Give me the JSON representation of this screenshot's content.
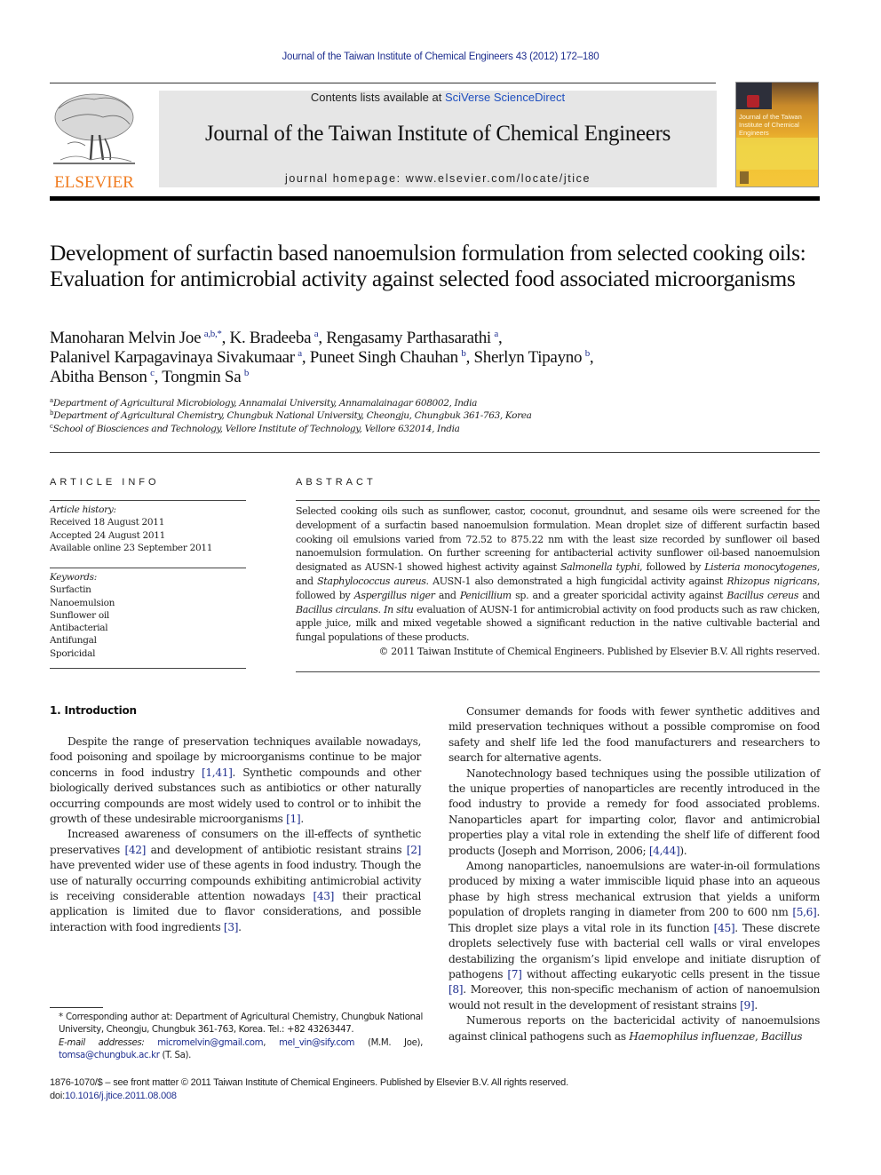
{
  "running_head": "Journal of the Taiwan Institute of Chemical Engineers 43 (2012) 172–180",
  "masthead": {
    "publisher_logo_text": "ELSEVIER",
    "contents_prefix": "Contents lists available at ",
    "contents_link": "SciVerse ScienceDirect",
    "journal_name": "Journal of the Taiwan Institute of Chemical Engineers",
    "homepage_label": "journal homepage: ",
    "homepage_url_text": "www.elsevier.com/locate/jtice",
    "cover_title": "Journal of the Taiwan Institute of Chemical Engineers",
    "colors": {
      "elsevier_orange": "#f07c20",
      "link_blue": "#1f2f8f",
      "banner_gray": "#e6e6e6"
    }
  },
  "article": {
    "title": "Development of surfactin based nanoemulsion formulation from selected cooking oils: Evaluation for antimicrobial activity against selected food associated microorganisms",
    "authors": [
      {
        "name": "Manoharan Melvin Joe",
        "sup": "a,b,*",
        "sep": ", "
      },
      {
        "name": "K. Bradeeba",
        "sup": "a",
        "sep": ", "
      },
      {
        "name": "Rengasamy Parthasarathi",
        "sup": "a",
        "sep": ","
      },
      {
        "name": "Palanivel Karpagavinaya Sivakumaar",
        "sup": "a",
        "sep": ", "
      },
      {
        "name": "Puneet Singh Chauhan",
        "sup": "b",
        "sep": ", "
      },
      {
        "name": "Sherlyn Tipayno",
        "sup": "b",
        "sep": ","
      },
      {
        "name": "Abitha Benson",
        "sup": "c",
        "sep": ", "
      },
      {
        "name": "Tongmin Sa",
        "sup": "b",
        "sep": ""
      }
    ],
    "affiliations": [
      {
        "key": "a",
        "text": "Department of Agricultural Microbiology, Annamalai University, Annamalainagar 608002, India"
      },
      {
        "key": "b",
        "text": "Department of Agricultural Chemistry, Chungbuk National University, Cheongju, Chungbuk 361-763, Korea"
      },
      {
        "key": "c",
        "text": "School of Biosciences and Technology, Vellore Institute of Technology, Vellore 632014, India"
      }
    ]
  },
  "article_info": {
    "heading": "ARTICLE INFO",
    "history_label": "Article history:",
    "history": [
      "Received 18 August 2011",
      "Accepted 24 August 2011",
      "Available online 23 September 2011"
    ],
    "keywords_label": "Keywords:",
    "keywords": [
      "Surfactin",
      "Nanoemulsion",
      "Sunflower oil",
      "Antibacterial",
      "Antifungal",
      "Sporicidal"
    ]
  },
  "abstract": {
    "heading": "ABSTRACT",
    "segments": [
      {
        "t": "Selected cooking oils such as sunflower, castor, coconut, groundnut, and sesame oils were screened for the development of a surfactin based nanoemulsion formulation. Mean droplet size of different surfactin based cooking oil emulsions varied from 72.52 to 875.22 nm with the least size recorded by sunflower oil based nanoemulsion formulation. On further screening for antibacterial activity sunflower oil-based nanoemulsion designated as AUSN-1 showed highest activity against "
      },
      {
        "t": "Salmonella typhi",
        "i": true
      },
      {
        "t": ", followed by "
      },
      {
        "t": "Listeria monocytogenes",
        "i": true
      },
      {
        "t": ", and "
      },
      {
        "t": "Staphylococcus aureus",
        "i": true
      },
      {
        "t": ". AUSN-1 also demonstrated a high fungicidal activity against "
      },
      {
        "t": "Rhizopus nigricans",
        "i": true
      },
      {
        "t": ", followed by "
      },
      {
        "t": "Aspergillus niger",
        "i": true
      },
      {
        "t": " and "
      },
      {
        "t": "Penicillium",
        "i": true
      },
      {
        "t": " sp. and a greater sporicidal activity against "
      },
      {
        "t": "Bacillus cereus",
        "i": true
      },
      {
        "t": " and "
      },
      {
        "t": "Bacillus circulans",
        "i": true
      },
      {
        "t": ". "
      },
      {
        "t": "In situ",
        "i": true
      },
      {
        "t": " evaluation of AUSN-1 for antimicrobial activity on food products such as raw chicken, apple juice, milk and mixed vegetable showed a significant reduction in the native cultivable bacterial and fungal populations of these products."
      }
    ],
    "copyright": "© 2011 Taiwan Institute of Chemical Engineers. Published by Elsevier B.V. All rights reserved."
  },
  "body": {
    "section_heading": "1.  Introduction",
    "left_paragraphs": [
      [
        {
          "t": "Despite the range of preservation techniques available nowa­days, food poisoning and spoilage by microorganisms continue to be major concerns in food industry "
        },
        {
          "t": "[1,41]",
          "ref": true
        },
        {
          "t": ". Synthetic compounds and other biologically derived substances such as antibiotics or other naturally occurring compounds are most widely used to control or to inhibit the growth of these undesirable microorgan­isms "
        },
        {
          "t": "[1]",
          "ref": true
        },
        {
          "t": "."
        }
      ],
      [
        {
          "t": "Increased awareness of consumers on the ill-effects of synthetic preservatives "
        },
        {
          "t": "[42]",
          "ref": true
        },
        {
          "t": " and development of antibiotic resistant strains "
        },
        {
          "t": "[2]",
          "ref": true
        },
        {
          "t": " have prevented wider use of these agents in food industry. Though the use of naturally occurring compounds exhibiting antimicrobial activity is receiving considerable attention nowa­days "
        },
        {
          "t": "[43]",
          "ref": true
        },
        {
          "t": " their practical application is limited due to flavor considerations, and possible interaction with food ingredients "
        },
        {
          "t": "[3]",
          "ref": true
        },
        {
          "t": "."
        }
      ]
    ],
    "right_paragraphs": [
      [
        {
          "t": "Consumer demands for foods with fewer synthetic additives and mild preservation techniques without a possible compromise on food safety and shelf life led the food manufacturers and researchers to search for alternative agents."
        }
      ],
      [
        {
          "t": "Nanotechnology based techniques using the possible utilization of the unique properties of nanoparticles are recently introduced in the food industry to provide a remedy for food associated problems. Nanoparticles apart for imparting color, flavor and antimicrobial properties play a vital role in extending the shelf life of different food products (Joseph and Morrison, 2006; "
        },
        {
          "t": "[4,44]",
          "ref": true
        },
        {
          "t": ")."
        }
      ],
      [
        {
          "t": "Among nanoparticles, nanoemulsions are water-in-oil formu­lations produced by mixing a water immiscible liquid phase into an aqueous phase by high stress mechanical extrusion that yields a uniform population of droplets ranging in diameter from 200 to 600 nm "
        },
        {
          "t": "[5,6]",
          "ref": true
        },
        {
          "t": ". This droplet size plays a vital role in its function "
        },
        {
          "t": "[45]",
          "ref": true
        },
        {
          "t": ". These discrete droplets selectively fuse with bacterial cell walls or viral envelopes destabilizing the organism’s lipid envelope and initiate disruption of pathogens "
        },
        {
          "t": "[7]",
          "ref": true
        },
        {
          "t": " without affecting eukaryotic cells present in the tissue "
        },
        {
          "t": "[8]",
          "ref": true
        },
        {
          "t": ". Moreover, this non-specific mechanism of action of nanoemulsion would not result in the development of resistant strains "
        },
        {
          "t": "[9]",
          "ref": true
        },
        {
          "t": "."
        }
      ],
      [
        {
          "t": "Numerous reports on the bactericidal activity of nanoemulsions against clinical pathogens such as "
        },
        {
          "t": "Haemophilus influenzae",
          "i": true
        },
        {
          "t": ", "
        },
        {
          "t": "Bacillus",
          "i": true
        }
      ]
    ]
  },
  "footnotes": {
    "corresponding": "* Corresponding author at: Department of Agricultural Chemistry, Chungbuk National University, Cheongju, Chungbuk 361-763, Korea. Tel.: +82 43263447.",
    "email_label": "E-mail addresses: ",
    "emails": [
      {
        "addr": "micromelvin@gmail.com",
        "after": ", "
      },
      {
        "addr": "mel_vin@sify.com",
        "after": " (M.M. Joe), "
      },
      {
        "addr": "tomsa@chungbuk.ac.kr",
        "after": " (T. Sa)."
      }
    ]
  },
  "imprint": {
    "line1": "1876-1070/$ – see front matter © 2011 Taiwan Institute of Chemical Engineers. Published by Elsevier B.V. All rights reserved.",
    "doi_label": "doi:",
    "doi": "10.1016/j.jtice.2011.08.008"
  }
}
